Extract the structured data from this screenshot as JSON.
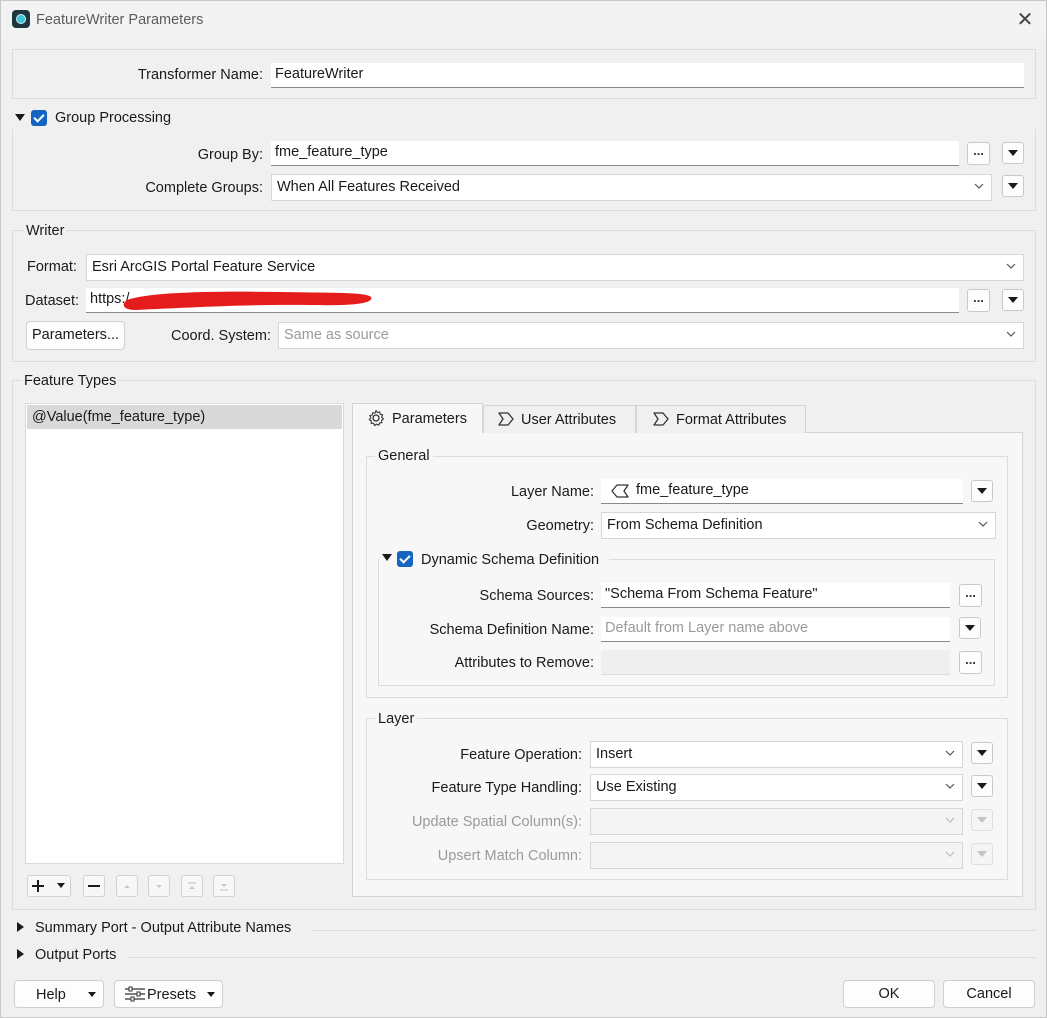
{
  "window": {
    "title": "FeatureWriter Parameters"
  },
  "transformer": {
    "name_label": "Transformer Name:",
    "name_value": "FeatureWriter"
  },
  "group_processing": {
    "label": "Group Processing",
    "group_by_label": "Group By:",
    "group_by_value": "fme_feature_type",
    "complete_groups_label": "Complete Groups:",
    "complete_groups_value": "When All Features Received"
  },
  "writer": {
    "section_label": "Writer",
    "format_label": "Format:",
    "format_value": "Esri ArcGIS Portal Feature Service",
    "dataset_label": "Dataset:",
    "dataset_value": "https:/",
    "parameters_button": "Parameters...",
    "coord_label": "Coord. System:",
    "coord_value": "Same as source"
  },
  "feature_types": {
    "section_label": "Feature Types",
    "items": [
      "@Value(fme_feature_type)"
    ]
  },
  "tabs": [
    {
      "label": "Parameters",
      "icon": "gear-icon"
    },
    {
      "label": "User Attributes",
      "icon": "attribute-icon"
    },
    {
      "label": "Format Attributes",
      "icon": "attribute-icon"
    }
  ],
  "general": {
    "section_label": "General",
    "layer_name_label": "Layer Name:",
    "layer_name_value": "fme_feature_type",
    "geometry_label": "Geometry:",
    "geometry_value": "From Schema Definition",
    "dynamic_schema_label": "Dynamic Schema Definition",
    "schema_sources_label": "Schema Sources:",
    "schema_sources_value": "\"Schema From Schema Feature\"",
    "schema_def_name_label": "Schema Definition Name:",
    "schema_def_name_placeholder": "Default from Layer name above",
    "attrs_remove_label": "Attributes to Remove:",
    "attrs_remove_value": ""
  },
  "layer": {
    "section_label": "Layer",
    "feature_operation_label": "Feature Operation:",
    "feature_operation_value": "Insert",
    "feature_type_handling_label": "Feature Type Handling:",
    "feature_type_handling_value": "Use Existing",
    "update_spatial_label": "Update Spatial Column(s):",
    "update_spatial_value": "",
    "upsert_match_label": "Upsert Match Column:",
    "upsert_match_value": ""
  },
  "collapsed_sections": {
    "summary_port": "Summary Port - Output Attribute Names",
    "output_ports": "Output Ports"
  },
  "footer": {
    "help": "Help",
    "presets": "Presets",
    "ok": "OK",
    "cancel": "Cancel"
  },
  "colors": {
    "checkbox": "#1565c0",
    "redaction": "#e51c1c",
    "selection": "#d9d9d9"
  }
}
